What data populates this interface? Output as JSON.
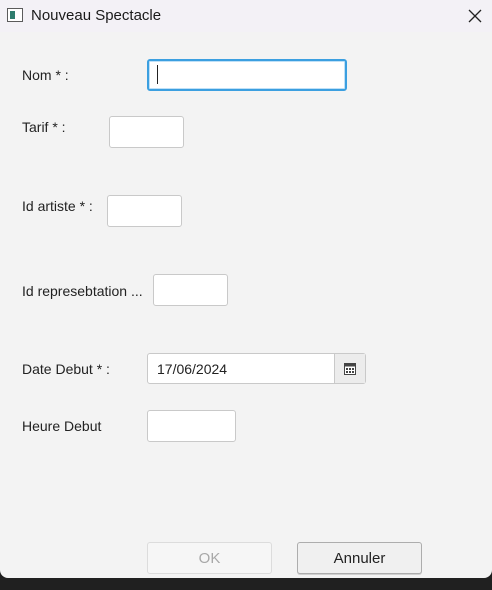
{
  "window": {
    "title": "Nouveau Spectacle",
    "icon": "app-window-icon",
    "close_icon": "close-icon"
  },
  "form": {
    "nom_label": "Nom * :",
    "nom_value": "",
    "tarif_label": "Tarif * :",
    "tarif_value": "",
    "id_artiste_label": "Id artiste * :",
    "id_artiste_value": "",
    "id_representation_label": "Id represebtation ...",
    "id_representation_value": "",
    "date_debut_label": "Date Debut * :",
    "date_debut_value": "17/06/2024",
    "calendar_icon": "calendar-icon",
    "heure_debut_label": "Heure Debut",
    "heure_debut_value": ""
  },
  "buttons": {
    "ok_label": "OK",
    "ok_enabled": false,
    "cancel_label": "Annuler"
  },
  "colors": {
    "focus_border": "#3b9fe0",
    "window_bg": "#f3f3f3",
    "titlebar_bg": "#f3f1f6"
  }
}
